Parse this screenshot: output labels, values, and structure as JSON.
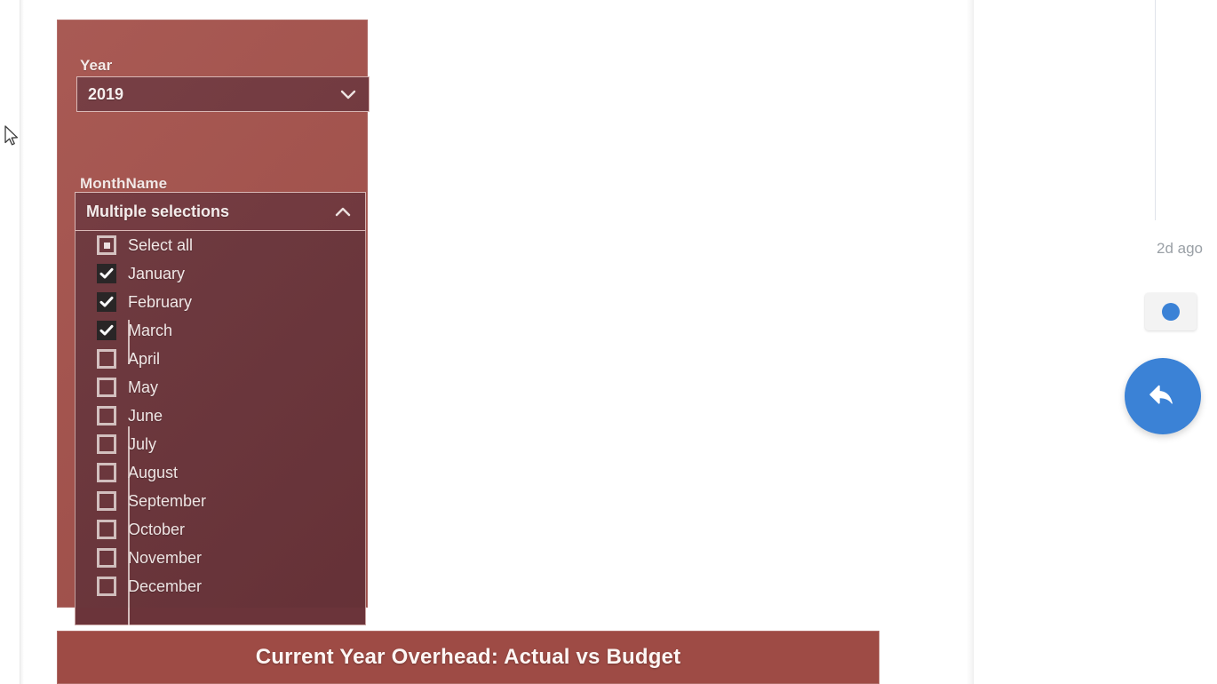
{
  "slicers": {
    "year": {
      "label": "Year",
      "selected_value": "2019",
      "chevron": "chevron-down-icon"
    },
    "month": {
      "label": "MonthName",
      "header_value": "Multiple selections",
      "chevron": "chevron-up-icon",
      "items": [
        {
          "label": "Select all",
          "state": "partial"
        },
        {
          "label": "January",
          "state": "checked"
        },
        {
          "label": "February",
          "state": "checked"
        },
        {
          "label": "March",
          "state": "checked"
        },
        {
          "label": "April",
          "state": "unchecked"
        },
        {
          "label": "May",
          "state": "unchecked"
        },
        {
          "label": "June",
          "state": "unchecked"
        },
        {
          "label": "July",
          "state": "unchecked"
        },
        {
          "label": "August",
          "state": "unchecked"
        },
        {
          "label": "September",
          "state": "unchecked"
        },
        {
          "label": "October",
          "state": "unchecked"
        },
        {
          "label": "November",
          "state": "unchecked"
        },
        {
          "label": "December",
          "state": "unchecked"
        }
      ]
    }
  },
  "chart": {
    "title": "Current Year Overhead: Actual vs Budget"
  },
  "right_rail": {
    "timestamp": "2d ago",
    "status_dot_icon": "blue-dot-icon",
    "reply_button_icon": "reply-arrow-icon"
  },
  "colors": {
    "panel_background": "#a4514b",
    "slicer_field_background": "#71363c",
    "slicer_list_background": "#6b343a",
    "chart_title_background": "#9e4b45",
    "accent_blue": "#3b82d6",
    "text_light": "#f6eceb",
    "timestamp_gray": "#9aa0a6"
  },
  "cursor": {
    "icon": "mouse-pointer-icon"
  }
}
